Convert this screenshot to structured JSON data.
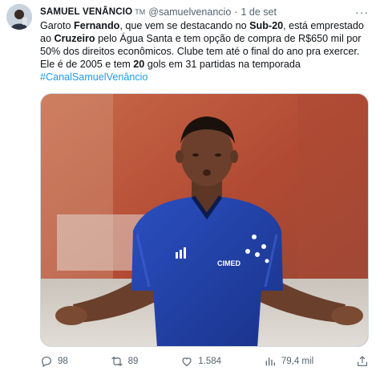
{
  "author": {
    "display_name": "SAMUEL VENÂNCIO",
    "name_badge": "TM",
    "handle": "@samuelvenancio",
    "separator": "·",
    "time": "1 de set"
  },
  "tweet": {
    "segments": [
      {
        "text": "Garoto ",
        "bold": false
      },
      {
        "text": "Fernando",
        "bold": true
      },
      {
        "text": ", que vem se destacando no ",
        "bold": false
      },
      {
        "text": "Sub-20",
        "bold": true
      },
      {
        "text": ", está emprestado ao ",
        "bold": false
      },
      {
        "text": "Cruzeiro",
        "bold": true
      },
      {
        "text": " pelo Água Santa e tem opção de compra de R$650 mil por 50% dos direitos econômicos. Clube tem até o final do ano pra exercer. Ele é de 2005 e tem ",
        "bold": false
      },
      {
        "text": "20",
        "bold": true
      },
      {
        "text": " gols em 31 partidas na temporada",
        "bold": false
      }
    ],
    "hashtag": "#CanalSamuelVenâncio"
  },
  "media": {
    "jersey_sponsor": "CIMED",
    "jersey_color": "#1f3fa3",
    "background_color": "#b8513a"
  },
  "actions": {
    "replies": "98",
    "retweets": "89",
    "likes": "1.584",
    "views": "79,4 mil"
  },
  "colors": {
    "text": "#0f1419",
    "secondary": "#536471",
    "link": "#1d9bf0"
  },
  "icons": {
    "more": "more-dots-icon",
    "reply": "reply-icon",
    "retweet": "retweet-icon",
    "like": "heart-icon",
    "views": "views-chart-icon",
    "share": "share-icon"
  }
}
